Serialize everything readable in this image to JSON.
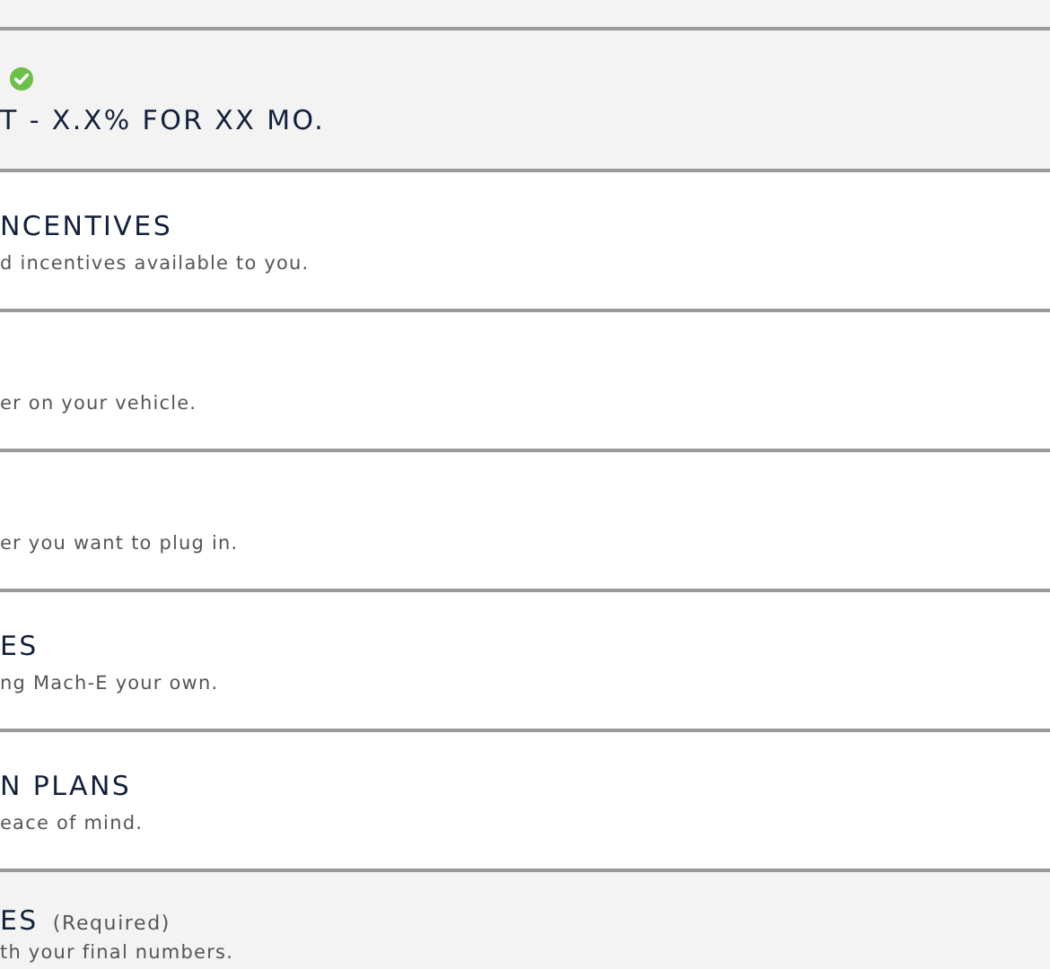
{
  "sections": [
    {
      "kind": "strip",
      "active": true
    },
    {
      "kind": "status",
      "active": true,
      "complete": true,
      "title": "T - X.X% FOR XX MO."
    },
    {
      "kind": "option",
      "active": false,
      "title": "NCENTIVES",
      "subtitle": "d incentives available to you."
    },
    {
      "kind": "option",
      "active": false,
      "subtitle": "er on your vehicle."
    },
    {
      "kind": "option",
      "active": false,
      "subtitle": "er you want to plug in."
    },
    {
      "kind": "option",
      "active": false,
      "title": "ES",
      "subtitle": "ng Mach-E your own."
    },
    {
      "kind": "option",
      "active": false,
      "title": "N PLANS",
      "subtitle": "eace of mind."
    },
    {
      "kind": "option",
      "active": true,
      "title": "ES",
      "note": "(Required)",
      "subtitle": "th your final numbers."
    }
  ]
}
